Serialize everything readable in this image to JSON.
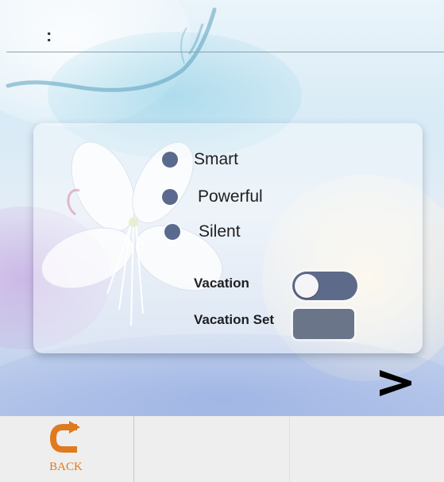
{
  "header": {
    "status_text": ":"
  },
  "modes": [
    {
      "label": "Smart",
      "selected": false
    },
    {
      "label": "Powerful",
      "selected": false
    },
    {
      "label": "Silent",
      "selected": false
    }
  ],
  "vacation": {
    "label": "Vacation",
    "enabled": false
  },
  "vacation_set": {
    "label": "Vacation Set",
    "value": ""
  },
  "navigation": {
    "next_icon": "chevron-right-icon",
    "back_label": "BACK",
    "back_icon": "return-arrow-icon"
  },
  "colors": {
    "radio": "#5a6a8e",
    "toggle_track": "#5e6a8a",
    "back_accent": "#e07a1f"
  }
}
